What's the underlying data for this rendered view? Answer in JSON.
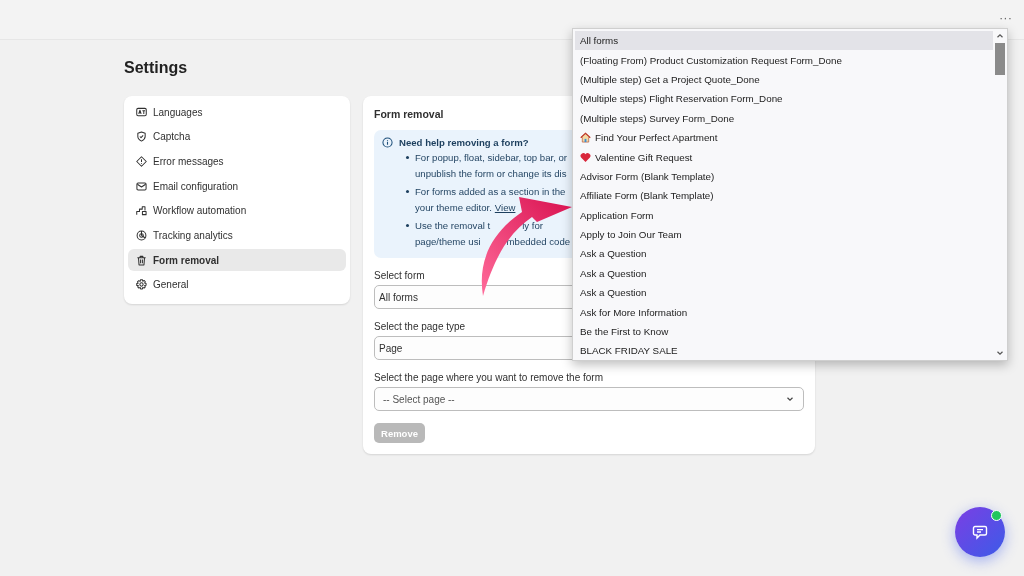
{
  "top_bar": {
    "more": "···"
  },
  "title": "Settings",
  "sidebar": {
    "items": [
      {
        "label": "Languages",
        "selected": false
      },
      {
        "label": "Captcha",
        "selected": false
      },
      {
        "label": "Error messages",
        "selected": false
      },
      {
        "label": "Email configuration",
        "selected": false
      },
      {
        "label": "Workflow automation",
        "selected": false
      },
      {
        "label": "Tracking analytics",
        "selected": false
      },
      {
        "label": "Form removal",
        "selected": true
      },
      {
        "label": "General",
        "selected": false
      }
    ]
  },
  "panel": {
    "title": "Form removal",
    "help": {
      "heading": "Need help removing a form?",
      "bullets": [
        {
          "lines": [
            [
              "For popup, float, sidebar, top bar, or"
            ],
            [
              "unpublish the form or change its dis"
            ]
          ]
        },
        {
          "lines": [
            [
              "For forms added as a section in the"
            ],
            [
              "your theme editor."
            ]
          ],
          "link": "View"
        },
        {
          "lines": [
            [
              "Use the removal t",
              "ly for"
            ],
            [
              "page/theme usi",
              "mbedded code"
            ]
          ]
        }
      ]
    },
    "fields": [
      {
        "label": "Select form",
        "value": "All forms"
      },
      {
        "label": "Select the page type",
        "value": "Page"
      },
      {
        "label": "Select the page where you want to remove the form",
        "placeholder": "-- Select page --"
      }
    ],
    "button": {
      "label": "Remove",
      "disabled": true
    }
  },
  "dropdown": {
    "options": [
      {
        "label": "All forms",
        "selected": true,
        "kind": "plain"
      },
      {
        "label": "(Floating From) Product Customization Request Form_Done",
        "selected": false,
        "kind": "plain"
      },
      {
        "label": "(Multiple step) Get a Project Quote_Done",
        "selected": false,
        "kind": "plain"
      },
      {
        "label": "(Multiple steps) Flight Reservation Form_Done",
        "selected": false,
        "kind": "plain"
      },
      {
        "label": "(Multiple steps) Survey Form_Done",
        "selected": false,
        "kind": "plain"
      },
      {
        "label": "Find Your Perfect Apartment",
        "selected": false,
        "kind": "house"
      },
      {
        "label": "Valentine Gift Request",
        "selected": false,
        "kind": "heart"
      },
      {
        "label": "Advisor Form (Blank Template)",
        "selected": false,
        "kind": "plain"
      },
      {
        "label": "Affiliate Form (Blank Template)",
        "selected": false,
        "kind": "plain"
      },
      {
        "label": "Application Form",
        "selected": false,
        "kind": "plain"
      },
      {
        "label": "Apply to Join Our Team",
        "selected": false,
        "kind": "plain"
      },
      {
        "label": "Ask a Question",
        "selected": false,
        "kind": "plain"
      },
      {
        "label": "Ask a Question",
        "selected": false,
        "kind": "plain"
      },
      {
        "label": "Ask a Question",
        "selected": false,
        "kind": "plain"
      },
      {
        "label": "Ask for More Information",
        "selected": false,
        "kind": "plain"
      },
      {
        "label": "Be the First to Know",
        "selected": false,
        "kind": "plain"
      },
      {
        "label": "BLACK FRIDAY SALE",
        "selected": false,
        "kind": "plain"
      }
    ]
  },
  "chat": {
    "online": true
  }
}
